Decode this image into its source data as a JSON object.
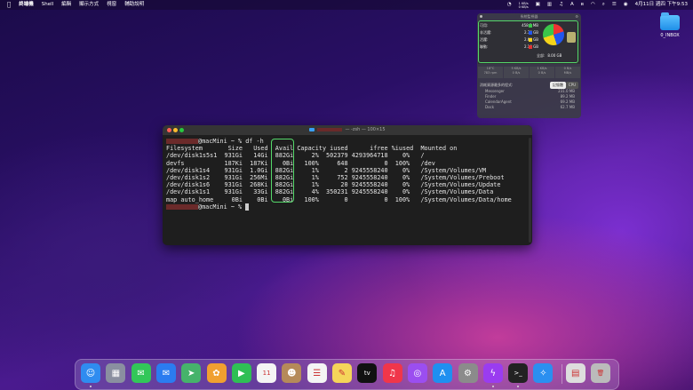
{
  "menubar": {
    "apple": "",
    "items": [
      "終端機",
      "Shell",
      "編輯",
      "顯示方式",
      "視窗",
      "輔助說明"
    ],
    "net_up": "1 KB/s",
    "net_down": "0 KB/s",
    "input_icon": "A",
    "datetime": "4月11日 週四 下午9:53"
  },
  "desktop": {
    "folder_label": "0_INBOX"
  },
  "widget": {
    "title": "系統監視器",
    "memory_rows": [
      {
        "label": "可用:",
        "value": "458.3 MB"
      },
      {
        "label": "非活躍:",
        "value": "2.78 GB"
      },
      {
        "label": "活躍:",
        "value": "2.68 GB"
      },
      {
        "label": "聯動:",
        "value": "2.10 GB"
      }
    ],
    "total_label": "全部:",
    "total_value": "8.00 GB",
    "colors": {
      "free": "#3bc54a",
      "inactive": "#2255ee",
      "active": "#f5d31a",
      "wired": "#e33333"
    },
    "graph_labels": [
      "18°C",
      "5 KB/s",
      "1 KB/s",
      "0 B/s"
    ],
    "graph_sub": [
      "783 rpm",
      "0 B/s",
      "0 B/s",
      "MB/s"
    ],
    "proc_header": "消耗資源最多的程式:",
    "tabs": [
      "記憶體",
      "CPU"
    ],
    "processes": [
      {
        "name": "Messenger",
        "value": "231.0 MB"
      },
      {
        "name": "Finder",
        "value": "89.2 MB"
      },
      {
        "name": "CalendarAgent",
        "value": "69.2 MB"
      },
      {
        "name": "Dock",
        "value": "62.7 MB"
      }
    ]
  },
  "terminal": {
    "title": "— -zsh — 100×15",
    "prompt_host": "@macMini ~ %",
    "command": "df -h",
    "header": "Filesystem       Size   Used  Avail Capacity iused      ifree %iused  Mounted on",
    "rows": [
      "/dev/disk1s5s1  931Gi   14Gi  882Gi     2%  502379 4293964718    0%   /",
      "devfs           187Ki  187Ki    0Bi   100%     648          0  100%   /dev",
      "/dev/disk1s4    931Gi  1.0Gi  882Gi     1%       2 9245558240    0%   /System/Volumes/VM",
      "/dev/disk1s2    931Gi  256Mi  882Gi     1%     752 9245558240    0%   /System/Volumes/Preboot",
      "/dev/disk1s6    931Gi  268Ki  882Gi     1%      20 9245558240    0%   /System/Volumes/Update",
      "/dev/disk1s1    931Gi   33Gi  882Gi     4%  350231 9245558240    0%   /System/Volumes/Data",
      "map auto_home     0Bi    0Bi    0Bi   100%       0          0  100%   /System/Volumes/Data/home"
    ],
    "prompt_end": "@macMini ~ %"
  },
  "dock": {
    "apps": [
      {
        "name": "Finder",
        "glyph": "☺",
        "color": "#2f8cf0"
      },
      {
        "name": "Launchpad",
        "glyph": "▦",
        "color": "#8a8fa0"
      },
      {
        "name": "Messages",
        "glyph": "✉",
        "color": "#32c759"
      },
      {
        "name": "Mail",
        "glyph": "✉",
        "color": "#2b7cf0"
      },
      {
        "name": "Maps",
        "glyph": "➤",
        "color": "#46b36b"
      },
      {
        "name": "Photos",
        "glyph": "✿",
        "color": "#f0a030"
      },
      {
        "name": "FaceTime",
        "glyph": "▶",
        "color": "#2fbf55"
      },
      {
        "name": "Calendar",
        "glyph": "11",
        "color": "#f4f4f4"
      },
      {
        "name": "Contacts",
        "glyph": "☻",
        "color": "#b58a5a"
      },
      {
        "name": "Reminders",
        "glyph": "☰",
        "color": "#f4f4f4"
      },
      {
        "name": "Notes",
        "glyph": "✎",
        "color": "#f5d55a"
      },
      {
        "name": "TV",
        "glyph": "tv",
        "color": "#111111"
      },
      {
        "name": "Music",
        "glyph": "♫",
        "color": "#f0364a"
      },
      {
        "name": "Podcasts",
        "glyph": "◎",
        "color": "#9b4ef0"
      },
      {
        "name": "App Store",
        "glyph": "A",
        "color": "#1f8ff0"
      },
      {
        "name": "System Preferences",
        "glyph": "⚙",
        "color": "#8b8b8b"
      },
      {
        "name": "Messenger",
        "glyph": "ϟ",
        "color": "#9a3cf0"
      },
      {
        "name": "Terminal",
        "glyph": ">_",
        "color": "#222222"
      },
      {
        "name": "Safari",
        "glyph": "✧",
        "color": "#2b8ff0"
      },
      {
        "name": "Preview",
        "glyph": "▤",
        "color": "#dddddd"
      },
      {
        "name": "Trash",
        "glyph": "🗑",
        "color": "#bbbbbb"
      }
    ]
  }
}
